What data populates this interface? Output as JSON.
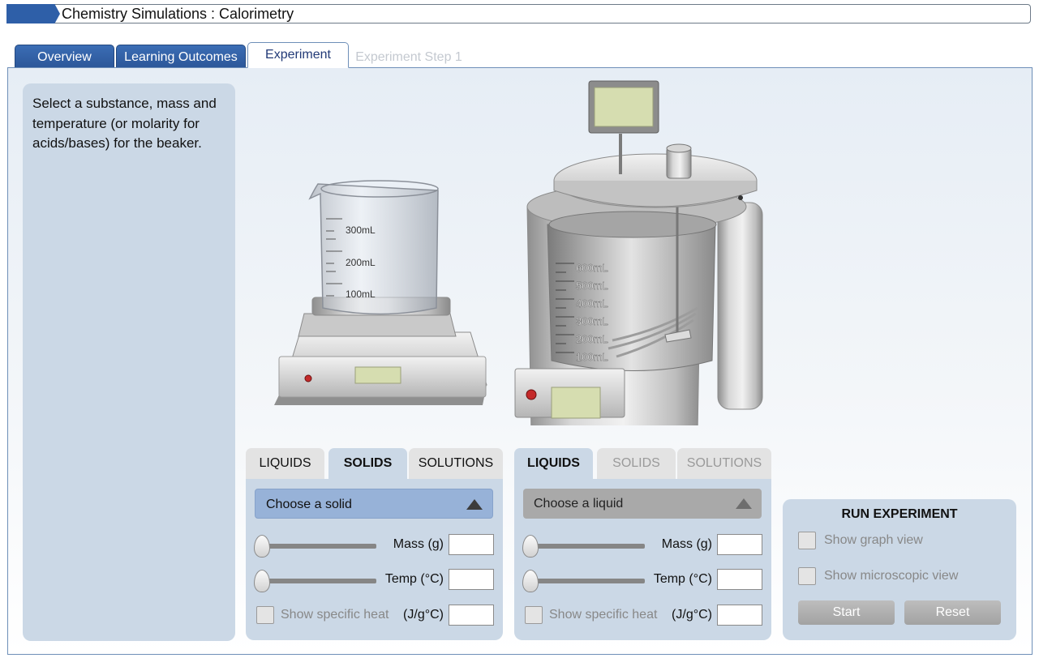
{
  "window": {
    "title": "Chemistry Simulations : Calorimetry"
  },
  "tabs": [
    {
      "label": "Overview",
      "state": "normal"
    },
    {
      "label": "Learning Outcomes",
      "state": "normal"
    },
    {
      "label": "Experiment",
      "state": "active"
    },
    {
      "label": "Experiment Step 1",
      "state": "disabled"
    }
  ],
  "instructions": "Select a substance, mass and temperature (or molarity for acids/bases) for the beaker.",
  "beaker": {
    "marks": [
      "300mL",
      "200mL",
      "100mL"
    ]
  },
  "calorimeter": {
    "marks": [
      "600mL",
      "500mL",
      "400mL",
      "300mL",
      "200mL",
      "100mL"
    ]
  },
  "beaker_controls": {
    "tabs": [
      {
        "label": "LIQUIDS",
        "state": "normal"
      },
      {
        "label": "SOLIDS",
        "state": "selected"
      },
      {
        "label": "SOLUTIONS",
        "state": "normal"
      }
    ],
    "dropdown": {
      "value": "Choose a solid"
    },
    "mass_label": "Mass (g)",
    "mass_value": "",
    "temp_label": "Temp (°C)",
    "temp_value": "",
    "specific_heat_label": "Show specific heat",
    "specific_heat_unit": "(J/g°C)",
    "specific_heat_value": ""
  },
  "calorimeter_controls": {
    "tabs": [
      {
        "label": "LIQUIDS",
        "state": "selected"
      },
      {
        "label": "SOLIDS",
        "state": "disabled"
      },
      {
        "label": "SOLUTIONS",
        "state": "disabled"
      }
    ],
    "dropdown": {
      "value": "Choose a liquid"
    },
    "mass_label": "Mass (g)",
    "mass_value": "",
    "temp_label": "Temp (°C)",
    "temp_value": "",
    "specific_heat_label": "Show specific heat",
    "specific_heat_unit": "(J/g°C)",
    "specific_heat_value": ""
  },
  "run": {
    "title": "RUN EXPERIMENT",
    "graph_view_label": "Show graph view",
    "micro_view_label": "Show microscopic view",
    "start_label": "Start",
    "reset_label": "Reset"
  },
  "colors": {
    "accent": "#2e5fa8",
    "panel": "#cbd8e6",
    "display": "#d6ddb0"
  },
  "icons": {
    "slider_thumb": "slider-thumb-icon",
    "dropdown_arrow": "triangle-up-icon"
  }
}
